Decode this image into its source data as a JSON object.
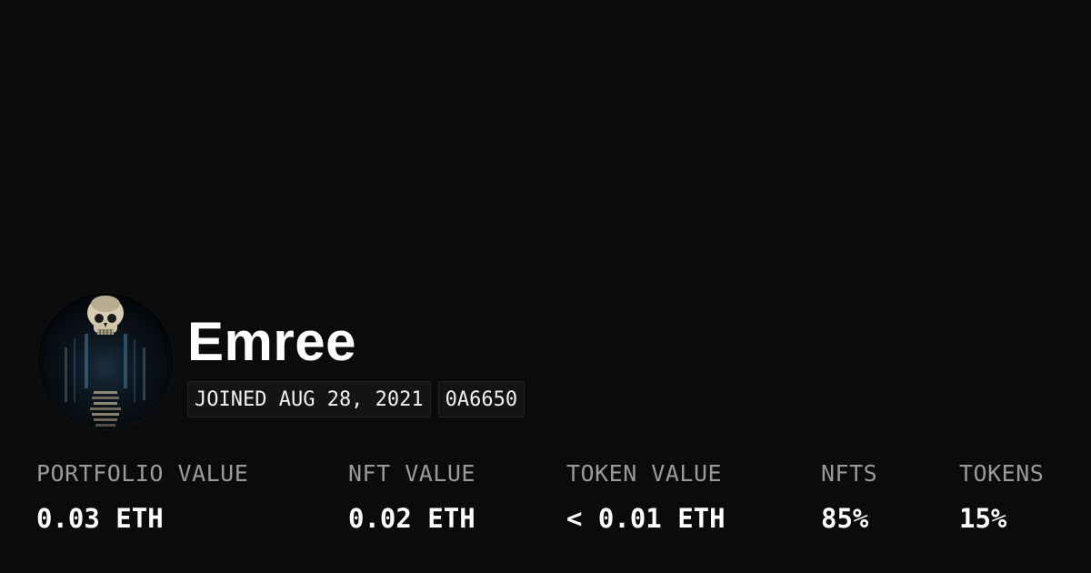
{
  "profile": {
    "name": "Emree",
    "joined": "JOINED AUG 28, 2021",
    "address_tag": "0A6650",
    "avatar_icon": "skull-avatar-icon"
  },
  "stats": [
    {
      "label": "PORTFOLIO VALUE",
      "value": "0.03 ETH"
    },
    {
      "label": "NFT VALUE",
      "value": "0.02 ETH"
    },
    {
      "label": "TOKEN VALUE",
      "value": "< 0.01 ETH"
    },
    {
      "label": "NFTS",
      "value": "85%"
    },
    {
      "label": "TOKENS",
      "value": "15%"
    }
  ],
  "colors": {
    "background": "#0b0b0b",
    "text_primary": "#ffffff",
    "text_muted": "#9a9a9a",
    "chip_background": "#141414"
  }
}
